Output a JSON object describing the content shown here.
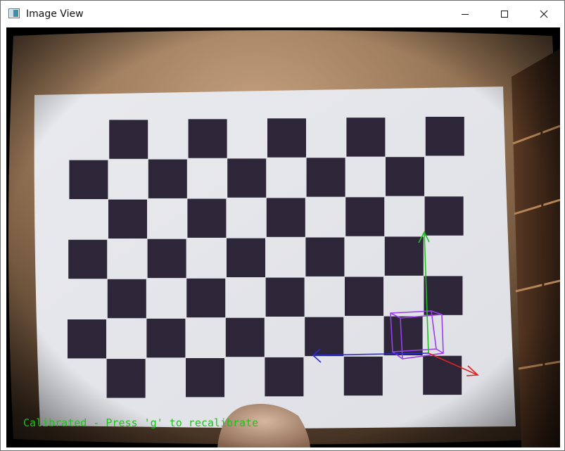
{
  "window": {
    "title": "Image View",
    "icon": "image-view-app-icon",
    "controls": {
      "minimize_icon": "minimize-icon",
      "maximize_icon": "maximize-icon",
      "close_icon": "close-icon"
    }
  },
  "image": {
    "description_icon": "camera-frame",
    "overlay_text": "Calibrated - Press 'g' to recalibrate",
    "colors": {
      "overlay_text": "#19c419",
      "axis_x": "#e12121",
      "axis_y": "#20c020",
      "axis_z": "#2b2bd6",
      "cube": "#9b3ef0",
      "board_light": "#e7e8ec",
      "board_dark": "#2c2638",
      "background_wall": "#8a6a4d"
    }
  }
}
